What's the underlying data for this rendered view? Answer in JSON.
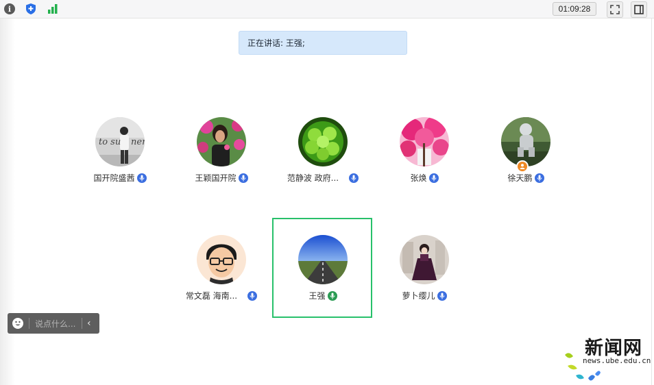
{
  "toolbar": {
    "timer": "01:09:28",
    "icons": [
      "info-icon",
      "shield-icon",
      "signal-icon",
      "fullscreen-icon",
      "side-panel-icon"
    ]
  },
  "speaking": {
    "text": "正在讲话: 王强;"
  },
  "participants": [
    {
      "name": "国开院盛茜",
      "mic": "active"
    },
    {
      "name": "王颖国开院",
      "mic": "active"
    },
    {
      "name": "范静波 政府...",
      "mic": "active"
    },
    {
      "name": "张焕",
      "mic": "active"
    },
    {
      "name": "徐天鹏",
      "mic": "active",
      "role": "host"
    },
    {
      "name": "常文磊 海南...",
      "mic": "active"
    },
    {
      "name": "王强",
      "mic": "speaking"
    },
    {
      "name": "萝卜缨儿",
      "mic": "active"
    }
  ],
  "avatars": {
    "p1_text": "to su   ner"
  },
  "chat": {
    "placeholder": "说点什么..."
  },
  "watermark": {
    "title": "新闻网",
    "url": "news.ube.edu.cn"
  },
  "colors": {
    "speaking_bg": "#d6e8fb",
    "highlight": "#27c06a",
    "mic": "#3b6ee0"
  }
}
